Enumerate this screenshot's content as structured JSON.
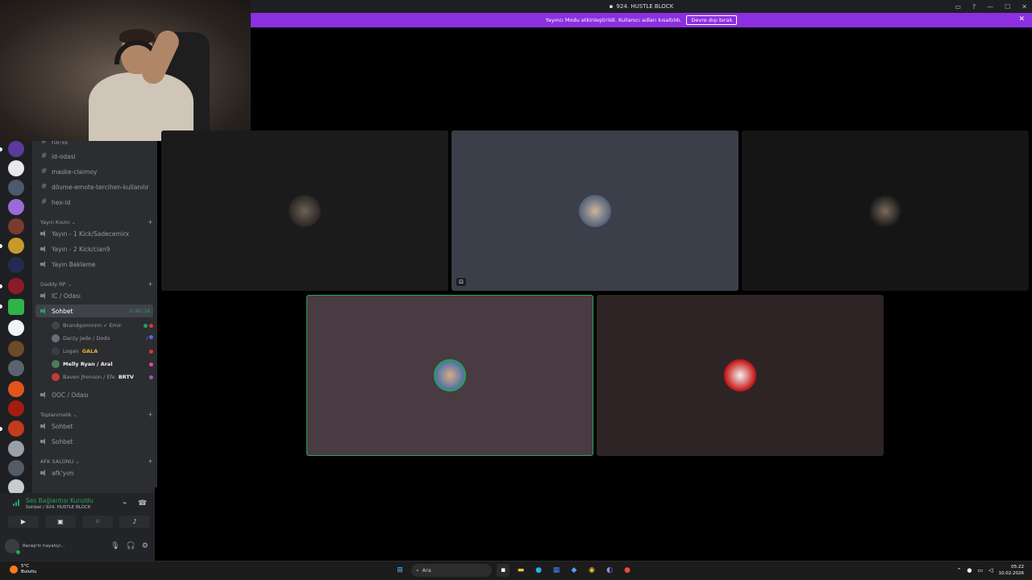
{
  "window": {
    "title": "924. HUSTLE BLOCK"
  },
  "notice": {
    "text": "Yayıncı Modu etkinleştirildi. Kullanıcı adları kısaltıldı.",
    "button": "Devre dışı bırak"
  },
  "channels": {
    "text": [
      "rol-ss",
      "id-odasi",
      "maske-claimoy",
      "dövme-emote-tercihen-kullanılır",
      "hex-id"
    ],
    "yayin_category": "Yayın Kısmı",
    "yayin": [
      "Yayın - 1 Kick/Sadecemirx",
      "Yayın - 2 Kick/cian9",
      "Yayın Bekleme"
    ],
    "daddy_category": "Daddy RP",
    "ic": "IC / Odası",
    "active": {
      "name": "Sohbet",
      "timer": "2:45:10"
    },
    "members": [
      {
        "name": "Brandgonnnnn ✓ Emir"
      },
      {
        "name": "Darzy Jade / Dodo"
      },
      {
        "name": "Logan",
        "tag": "GALA"
      },
      {
        "name": "Melly Ryan / Aral"
      },
      {
        "name": "Baven Jhonson / Efe",
        "tag": "BRTV"
      }
    ],
    "ooc": "OOC / Odası",
    "toplanmalik_category": "Toplanmalık",
    "toplanmalik": [
      "Sohbet",
      "Sohbet"
    ],
    "afk_category": "AFK SALONU",
    "afk": "afk'yım"
  },
  "voice": {
    "status": "Ses Bağlantısı Kuruldu",
    "sub": "Sohbet / 924. HUSTLE BLOCK",
    "user_status": "Recep'in hayatıyl..."
  },
  "taskbar": {
    "temp": "5°C",
    "weather": "Bulutlu",
    "search": "Ara",
    "time": "05:22",
    "date": "10.02.2026"
  },
  "colors": {
    "accent": "#8b2fe0",
    "green": "#23a55a",
    "bg": "#000000"
  }
}
